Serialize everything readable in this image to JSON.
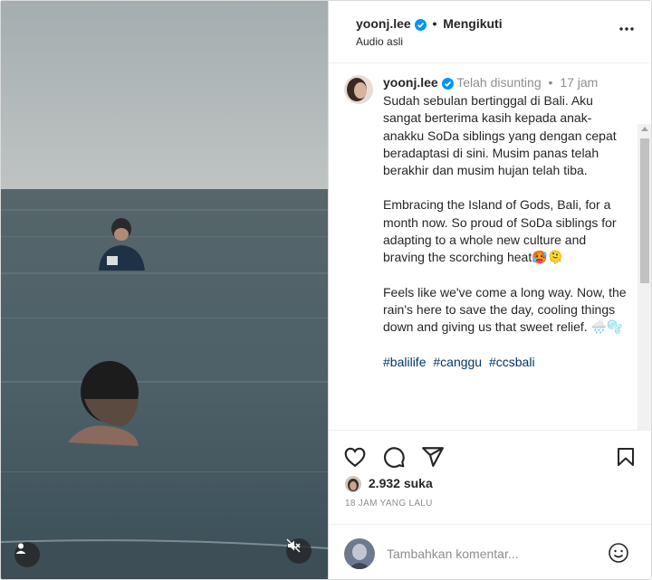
{
  "header": {
    "username": "yoonj.lee",
    "separator": "•",
    "follow_status": "Mengikuti",
    "audio_label": "Audio asli"
  },
  "caption": {
    "username": "yoonj.lee",
    "edited_label": "Telah disunting",
    "separator": "•",
    "time": "17 jam",
    "paragraphs": [
      "Sudah sebulan bertinggal di Bali. Aku sangat berterima kasih kepada anak-anakku SoDa siblings yang dengan cepat beradaptasi di sini. Musim panas telah berakhir dan musim hujan telah tiba.",
      "Embracing the Island of Gods, Bali, for a month now. So proud of SoDa siblings for adapting to a whole new culture and braving the scorching heat🥵🫠",
      "Feels like we've come a long way. Now, the rain's here to save the day, cooling things down and giving us that sweet relief. 🌧️🫧"
    ],
    "hashtags": [
      "#balilife",
      "#canggu",
      "#ccsbali"
    ]
  },
  "stats": {
    "likes_count": "2.932",
    "likes_label": "suka",
    "timestamp": "18 JAM YANG LALU"
  },
  "comment": {
    "placeholder": "Tambahkan komentar..."
  },
  "icons": {
    "verified": "verified-badge-icon",
    "more": "more-options-icon",
    "like": "heart-icon",
    "comment": "comment-icon",
    "share": "share-icon",
    "save": "bookmark-icon",
    "emoji": "emoji-icon",
    "user_tag": "user-tag-icon",
    "mute": "mute-icon"
  },
  "colors": {
    "verified": "#0095f6",
    "link": "#00376b",
    "secondary_text": "#8e8e8e"
  }
}
